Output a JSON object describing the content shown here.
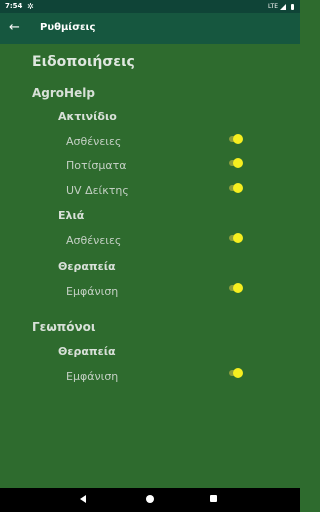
{
  "status_bar": {
    "time": "7:54",
    "network": "LTE"
  },
  "toolbar": {
    "title": "Ρυθμίσεις"
  },
  "settings": {
    "heading": "Ειδοποιήσεις",
    "agrohelp": {
      "title": "AgroHelp",
      "kiwi": {
        "title": "Ακτινίδιο",
        "items": [
          {
            "label": "Ασθένειες",
            "on": true
          },
          {
            "label": "Ποτίσματα",
            "on": true
          },
          {
            "label": "UV Δείκτης",
            "on": true
          }
        ]
      },
      "olive": {
        "title": "Ελιά",
        "items": [
          {
            "label": "Ασθένειες",
            "on": true
          }
        ]
      },
      "therapy": {
        "title": "Θεραπεία",
        "items": [
          {
            "label": "Εμφάνιση",
            "on": true
          }
        ]
      }
    },
    "agronomists": {
      "title": "Γεωπόνοι",
      "therapy": {
        "title": "Θεραπεία",
        "items": [
          {
            "label": "Εμφάνιση",
            "on": true
          }
        ]
      }
    }
  },
  "colors": {
    "status_bar": "#0f4437",
    "toolbar": "#16573f",
    "background": "#2e6b2e",
    "toggle_thumb": "#f6ee1f",
    "toggle_track": "#8b9b3d"
  }
}
